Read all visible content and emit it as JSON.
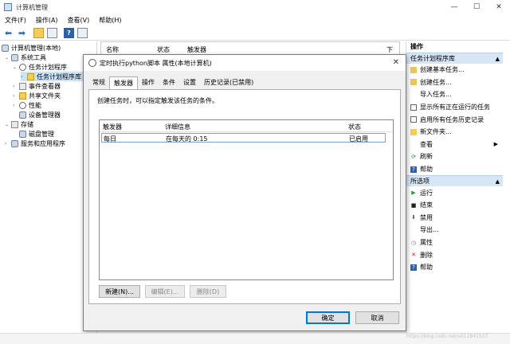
{
  "window": {
    "title": "计算机管理",
    "controls": {
      "minimize": "—",
      "maximize": "☐",
      "close": "✕"
    }
  },
  "menu": [
    "文件(F)",
    "操作(A)",
    "查看(V)",
    "帮助(H)"
  ],
  "toolbar": {
    "icons": [
      "back-arrow-icon",
      "forward-arrow-icon",
      "folder-up-icon",
      "show-hide-tree-icon",
      "help-icon",
      "mmc-window-icon"
    ],
    "glyphs": {
      "back": "⬅",
      "forward": "➡",
      "help": "?"
    }
  },
  "tree": {
    "root": "计算机管理(本地)",
    "system_tools": "系统工具",
    "task_scheduler": "任务计划程序",
    "task_scheduler_library": "任务计划程序库",
    "event_viewer": "事件查看器",
    "shared_folders": "共享文件夹",
    "performance": "性能",
    "device_manager": "设备管理器",
    "storage": "存储",
    "disk_management": "磁盘管理",
    "services_apps": "服务和应用程序"
  },
  "list_header": {
    "col_name": "名称",
    "col_status": "状态",
    "col_trigger": "触发器",
    "sort_glyph": "下"
  },
  "actions": {
    "title": "操作",
    "section1": {
      "header": "任务计划程序库",
      "items": [
        "创建基本任务...",
        "创建任务...",
        "导入任务...",
        "显示所有正在运行的任务",
        "启用所有任务历史记录",
        "新文件夹...",
        "查看",
        "刷新",
        "帮助"
      ]
    },
    "section2": {
      "header": "所选项",
      "items": [
        "运行",
        "结束",
        "禁用",
        "导出...",
        "属性",
        "删除",
        "帮助"
      ]
    },
    "collapse_glyph": "▲",
    "submenu_glyph": "▶"
  },
  "dialog": {
    "title": "定时执行python脚本 属性(本地计算机)",
    "close_glyph": "✕",
    "tabs": [
      "常规",
      "触发器",
      "操作",
      "条件",
      "设置",
      "历史记录(已禁用)"
    ],
    "active_tab": "触发器",
    "description": "创建任务时，可以指定触发该任务的条件。",
    "table": {
      "headers": [
        "触发器",
        "详细信息",
        "状态"
      ],
      "rows": [
        {
          "trigger": "每日",
          "details": "在每天的 0:15",
          "status": "已启用"
        }
      ]
    },
    "buttons": {
      "new": "新建(N)...",
      "edit": "编辑(E)...",
      "delete": "删除(D)",
      "ok": "确定",
      "cancel": "取消"
    }
  },
  "watermark": "https://blog.csdn.net/u012841527"
}
